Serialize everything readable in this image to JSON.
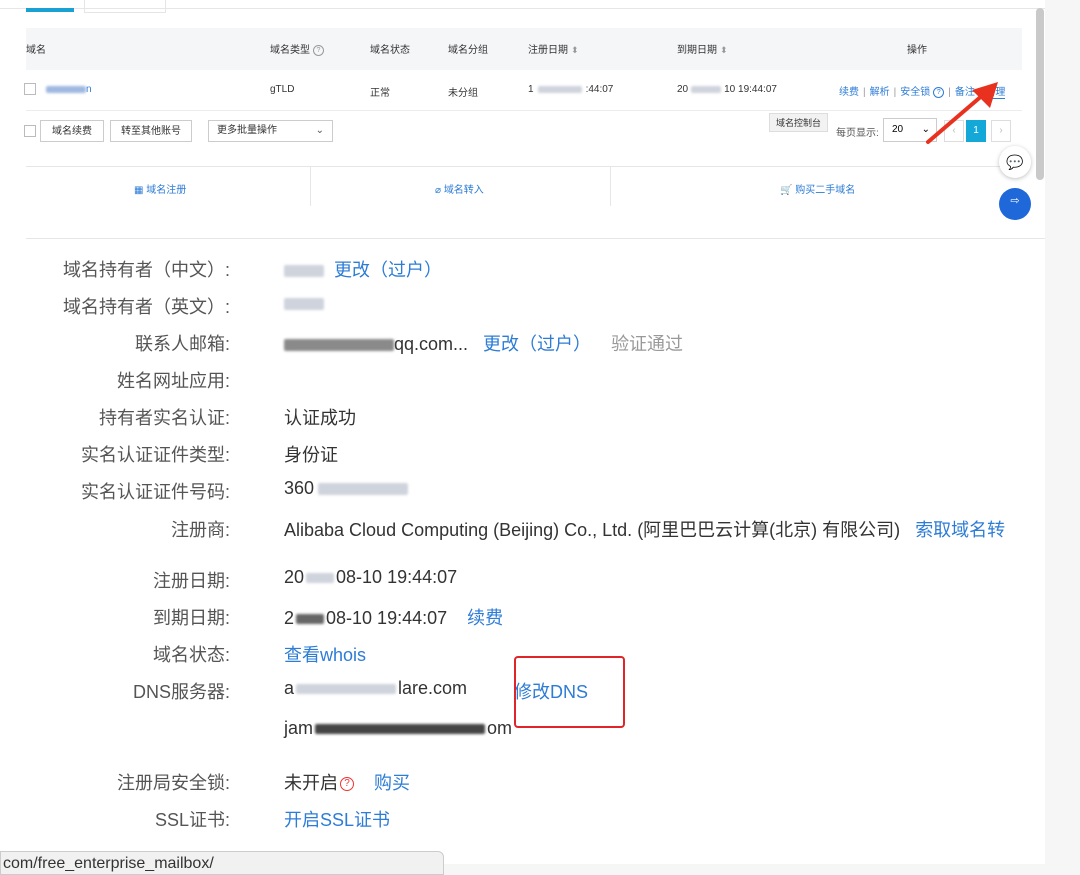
{
  "domain_list": {
    "columns": {
      "domain": "域名",
      "type": "域名类型",
      "status": "域名状态",
      "group": "域名分组",
      "reg_date": "注册日期",
      "exp_date": "到期日期",
      "ops": "操作"
    },
    "row": {
      "domain_suffix": "n",
      "type": "gTLD",
      "status": "正常",
      "group": "未分组",
      "reg_date_visible": "1",
      "reg_time": ":44:07",
      "exp_date_prefix": "20",
      "exp_date_mid": "10 19:44:07",
      "ops": [
        "续费",
        "解析",
        "安全锁",
        "备注",
        "管理"
      ]
    },
    "bulk": {
      "renew": "域名续费",
      "transfer": "转至其他账号",
      "more": "更多批量操作"
    },
    "tooltip": "域名控制台",
    "pager": {
      "per_page_label": "每页显示:",
      "per_page": "20",
      "current": "1"
    },
    "actions": [
      "域名注册",
      "域名转入",
      "购买二手域名"
    ]
  },
  "details": {
    "owner_cn": {
      "label": "域名持有者（中文）:",
      "link": "更改（过户）"
    },
    "owner_en": {
      "label": "域名持有者（英文）:"
    },
    "email": {
      "label": "联系人邮箱:",
      "value_tail": "qq.com...",
      "link": "更改（过户）",
      "status": "验证通过"
    },
    "name_app": {
      "label": "姓名网址应用:"
    },
    "realname": {
      "label": "持有者实名认证:",
      "value": "认证成功"
    },
    "cert_type": {
      "label": "实名认证证件类型:",
      "value": "身份证"
    },
    "cert_no": {
      "label": "实名认证证件号码:",
      "value_head": "360"
    },
    "registrar": {
      "label": "注册商:",
      "value": "Alibaba Cloud Computing (Beijing) Co., Ltd. (阿里巴巴云计算(北京) 有限公司)",
      "link": "索取域名转"
    },
    "reg_date": {
      "label": "注册日期:",
      "value_head": "20",
      "value_tail": "08-10 19:44:07"
    },
    "exp_date": {
      "label": "到期日期:",
      "value_head": "2",
      "value_tail": "08-10 19:44:07",
      "link": "续费"
    },
    "status": {
      "label": "域名状态:",
      "link": "查看whois"
    },
    "dns": {
      "label": "DNS服务器:",
      "ns1_head": "a",
      "ns1_tail": "lare.com",
      "ns2_head": "jam",
      "ns2_tail": "om",
      "link": "修改DNS"
    },
    "lock": {
      "label": "注册局安全锁:",
      "value": "未开启",
      "link": "购买"
    },
    "ssl": {
      "label": "SSL证书:",
      "link": "开启SSL证书"
    }
  },
  "status_bar": {
    "url": "com/free_enterprise_mailbox/"
  }
}
